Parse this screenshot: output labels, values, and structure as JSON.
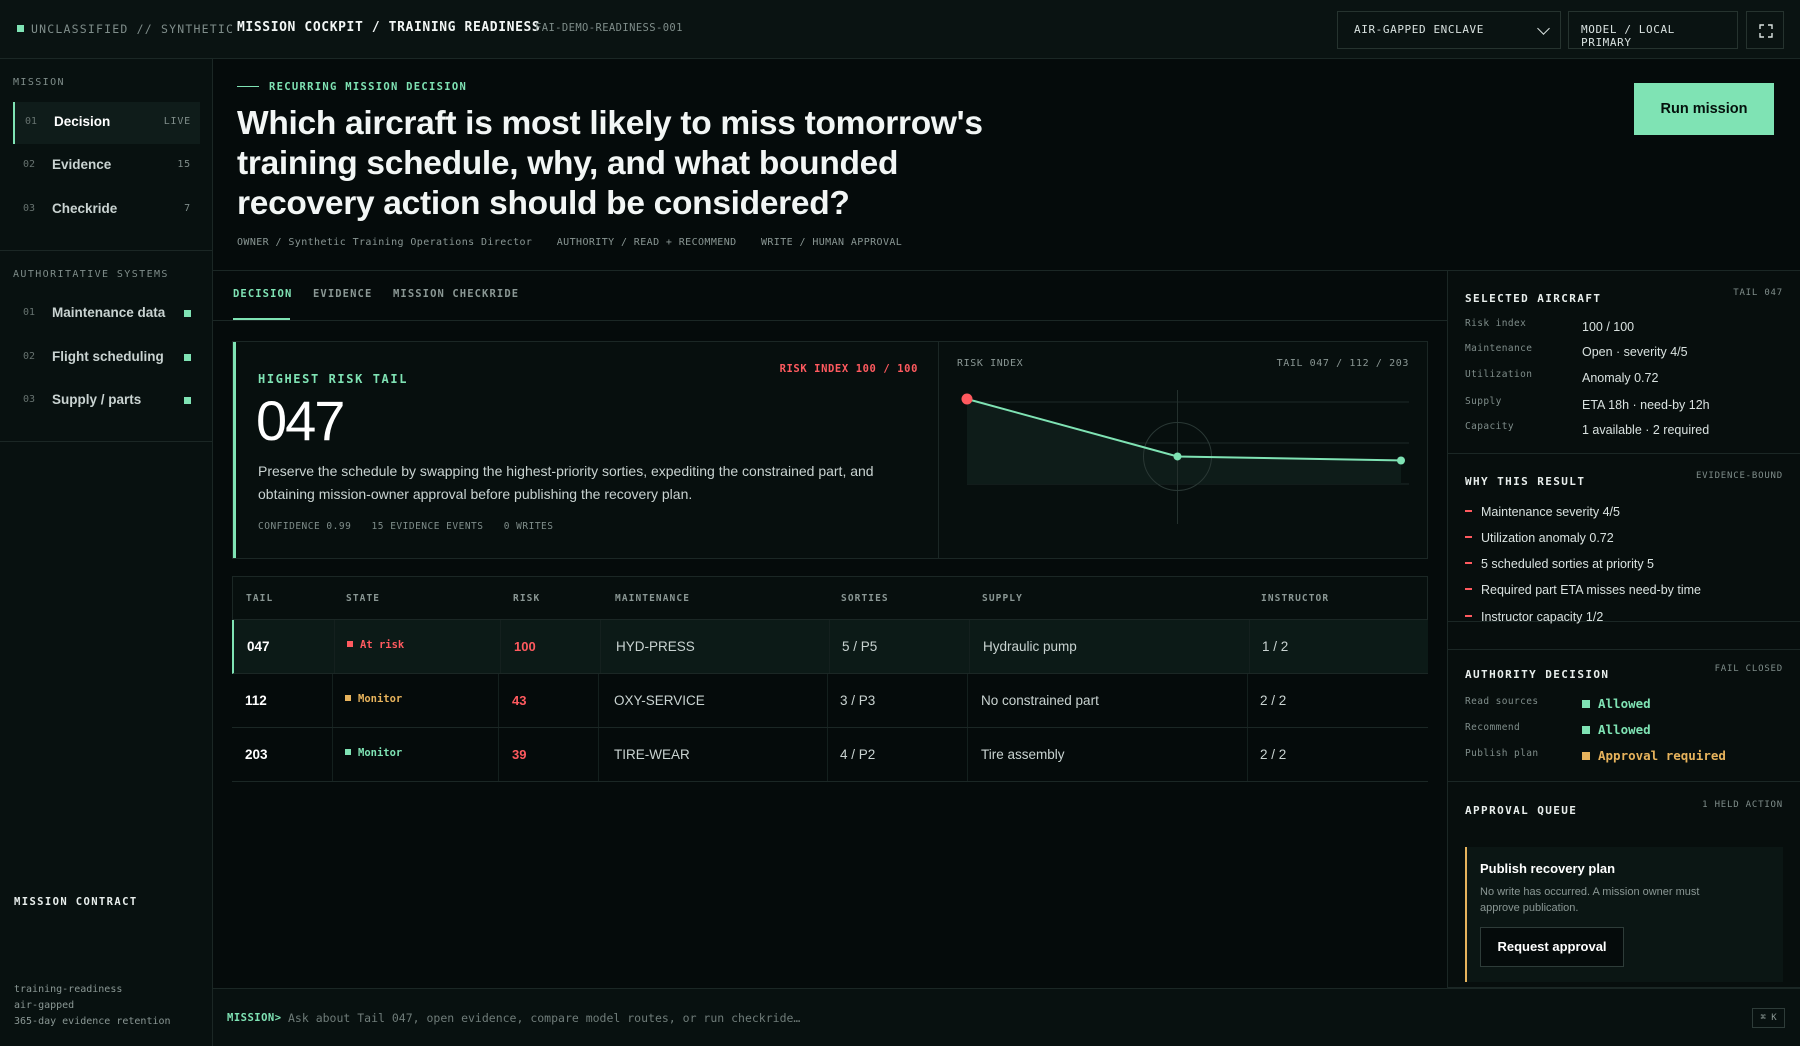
{
  "topbar": {
    "classification": "UNCLASSIFIED // SYNTHETIC",
    "title": "MISSION COCKPIT / TRAINING READINESS",
    "run_id": "FAI-DEMO-READINESS-001",
    "environment": "AIR-GAPPED ENCLAVE",
    "model": "MODEL / LOCAL PRIMARY",
    "fullscreen_icon": "expand-icon"
  },
  "sidebar": {
    "mission_label": "MISSION",
    "mission_items": [
      {
        "num": "01",
        "label": "Decision",
        "meta": "LIVE"
      },
      {
        "num": "02",
        "label": "Evidence",
        "meta": "15"
      },
      {
        "num": "03",
        "label": "Checkride",
        "meta": "7"
      }
    ],
    "systems_label": "AUTHORITATIVE SYSTEMS",
    "systems": [
      {
        "num": "01",
        "label": "Maintenance data"
      },
      {
        "num": "02",
        "label": "Flight scheduling"
      },
      {
        "num": "03",
        "label": "Supply / parts"
      }
    ],
    "contract_title": "MISSION CONTRACT",
    "contract_lines": [
      "training-readiness",
      "air-gapped",
      "365-day evidence retention"
    ]
  },
  "header": {
    "eyebrow": "RECURRING MISSION DECISION",
    "question": "Which aircraft is most likely to miss tomorrow's training schedule, why, and what bounded recovery action should be considered?",
    "owner": "OWNER / Synthetic Training Operations Director",
    "authority": "AUTHORITY / READ + RECOMMEND",
    "write": "WRITE / HUMAN APPROVAL",
    "run_button": "Run mission"
  },
  "tabs": [
    "DECISION",
    "EVIDENCE",
    "MISSION CHECKRIDE"
  ],
  "risk": {
    "title": "HIGHEST RISK TAIL",
    "index_badge": "RISK INDEX 100 / 100",
    "tail": "047",
    "description": "Preserve the schedule by swapping the highest-priority sorties, expediting the constrained part, and obtaining mission-owner approval before publishing the recovery plan.",
    "confidence": "CONFIDENCE 0.99",
    "events": "15 EVIDENCE EVENTS",
    "writes": "0 WRITES",
    "chart_label": "RISK INDEX",
    "chart_legend": "TAIL 047 / 112 / 203"
  },
  "chart_data": {
    "type": "line",
    "categories": [
      "047",
      "112",
      "203"
    ],
    "values": [
      100,
      43,
      39
    ],
    "title": "RISK INDEX",
    "legend": "TAIL 047 / 112 / 203",
    "colors": {
      "line": "#7fe3b4",
      "highlight": "#ff5a5f"
    }
  },
  "table": {
    "headers": [
      "TAIL",
      "STATE",
      "RISK",
      "MAINTENANCE",
      "SORTIES",
      "SUPPLY",
      "INSTRUCTOR"
    ],
    "rows": [
      {
        "tail": "047",
        "state": "At risk",
        "state_color": "#ff5a5f",
        "risk": "100",
        "maintenance": "HYD-PRESS",
        "sorties": "5 / P5",
        "supply": "Hydraulic pump",
        "instructor": "1 / 2"
      },
      {
        "tail": "112",
        "state": "Monitor",
        "state_color": "#e7b35c",
        "risk": "43",
        "maintenance": "OXY-SERVICE",
        "sorties": "3 / P3",
        "supply": "No constrained part",
        "instructor": "2 / 2"
      },
      {
        "tail": "203",
        "state": "Monitor",
        "state_color": "#7fe3b4",
        "risk": "39",
        "maintenance": "TIRE-WEAR",
        "sorties": "4 / P2",
        "supply": "Tire assembly",
        "instructor": "2 / 2"
      }
    ]
  },
  "right": {
    "selected": {
      "title": "SELECTED AIRCRAFT",
      "tag": "TAIL 047",
      "rows": [
        {
          "k": "Risk index",
          "v": "100 / 100"
        },
        {
          "k": "Maintenance",
          "v": "Open · severity 4/5"
        },
        {
          "k": "Utilization",
          "v": "Anomaly 0.72"
        },
        {
          "k": "Supply",
          "v": "ETA 18h · need-by 12h"
        },
        {
          "k": "Capacity",
          "v": "1 available · 2 required"
        }
      ]
    },
    "why": {
      "title": "WHY THIS RESULT",
      "tag": "EVIDENCE-BOUND",
      "items": [
        "Maintenance severity 4/5",
        "Utilization anomaly 0.72",
        "5 scheduled sorties at priority 5",
        "Required part ETA misses need-by time",
        "Instructor capacity 1/2"
      ]
    },
    "authority": {
      "title": "AUTHORITY DECISION",
      "tag": "FAIL CLOSED",
      "rows": [
        {
          "k": "Read sources",
          "v": "Allowed",
          "color": "#7fe3b4"
        },
        {
          "k": "Recommend",
          "v": "Allowed",
          "color": "#7fe3b4"
        },
        {
          "k": "Publish plan",
          "v": "Approval required",
          "color": "#e7b35c"
        }
      ]
    },
    "approval": {
      "title": "APPROVAL QUEUE",
      "tag": "1 HELD ACTION",
      "card_title": "Publish recovery plan",
      "card_desc": "No write has occurred. A mission owner must approve publication.",
      "button": "Request approval"
    }
  },
  "command": {
    "prompt": "MISSION>",
    "placeholder": "Ask about Tail 047, open evidence, compare model routes, or run checkride…",
    "shortcut": "⌘ K"
  }
}
